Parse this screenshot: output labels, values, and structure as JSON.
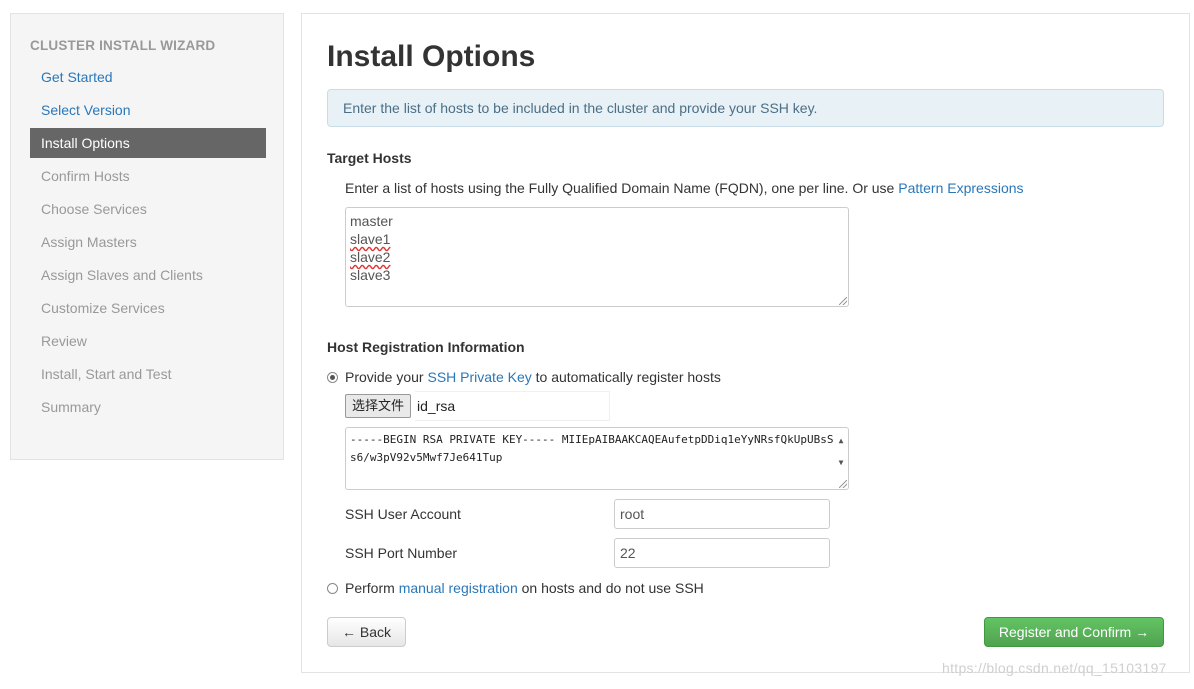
{
  "sidebar": {
    "title": "CLUSTER INSTALL WIZARD",
    "items": [
      {
        "label": "Get Started",
        "state": "done"
      },
      {
        "label": "Select Version",
        "state": "done"
      },
      {
        "label": "Install Options",
        "state": "active"
      },
      {
        "label": "Confirm Hosts",
        "state": "pending"
      },
      {
        "label": "Choose Services",
        "state": "pending"
      },
      {
        "label": "Assign Masters",
        "state": "pending"
      },
      {
        "label": "Assign Slaves and Clients",
        "state": "pending"
      },
      {
        "label": "Customize Services",
        "state": "pending"
      },
      {
        "label": "Review",
        "state": "pending"
      },
      {
        "label": "Install, Start and Test",
        "state": "pending"
      },
      {
        "label": "Summary",
        "state": "pending"
      }
    ]
  },
  "main": {
    "title": "Install Options",
    "alert": "Enter the list of hosts to be included in the cluster and provide your SSH key.",
    "target_hosts": {
      "heading": "Target Hosts",
      "description": "Enter a list of hosts using the Fully Qualified Domain Name (FQDN), one per line. Or use",
      "link": "Pattern Expressions",
      "hosts": [
        "master",
        "slave1",
        "slave2",
        "slave3"
      ]
    },
    "registration": {
      "heading": "Host Registration Information",
      "ssh_option": {
        "prefix": "Provide your",
        "link": "SSH Private Key",
        "suffix": "to automatically register hosts",
        "checked": true
      },
      "file_button": "选择文件",
      "file_name": "id_rsa",
      "key_text": "-----BEGIN RSA PRIVATE KEY----- MIIEpAIBAAKCAQEAufetpDDiq1eYyNRsfQkUpUBsSs6/w3pV92v5Mwf7Je641Tup",
      "ssh_user_label": "SSH User Account",
      "ssh_user_value": "root",
      "ssh_port_label": "SSH Port Number",
      "ssh_port_value": "22",
      "manual_option": {
        "prefix": "Perform",
        "link": "manual registration",
        "suffix": "on hosts and do not use SSH",
        "checked": false
      }
    },
    "back_button": "← Back",
    "register_button": "Register and Confirm →"
  },
  "watermark": "https://blog.csdn.net/qq_15103197",
  "colors": {
    "link": "#2a77b8",
    "active_nav_bg": "#666666",
    "success_button": "#5bb75b",
    "alert_bg": "#e8f1f6"
  },
  "icons": [
    "radio-checked-icon",
    "radio-unchecked-icon",
    "resize-grip-icon",
    "scroll-arrows-icon"
  ]
}
